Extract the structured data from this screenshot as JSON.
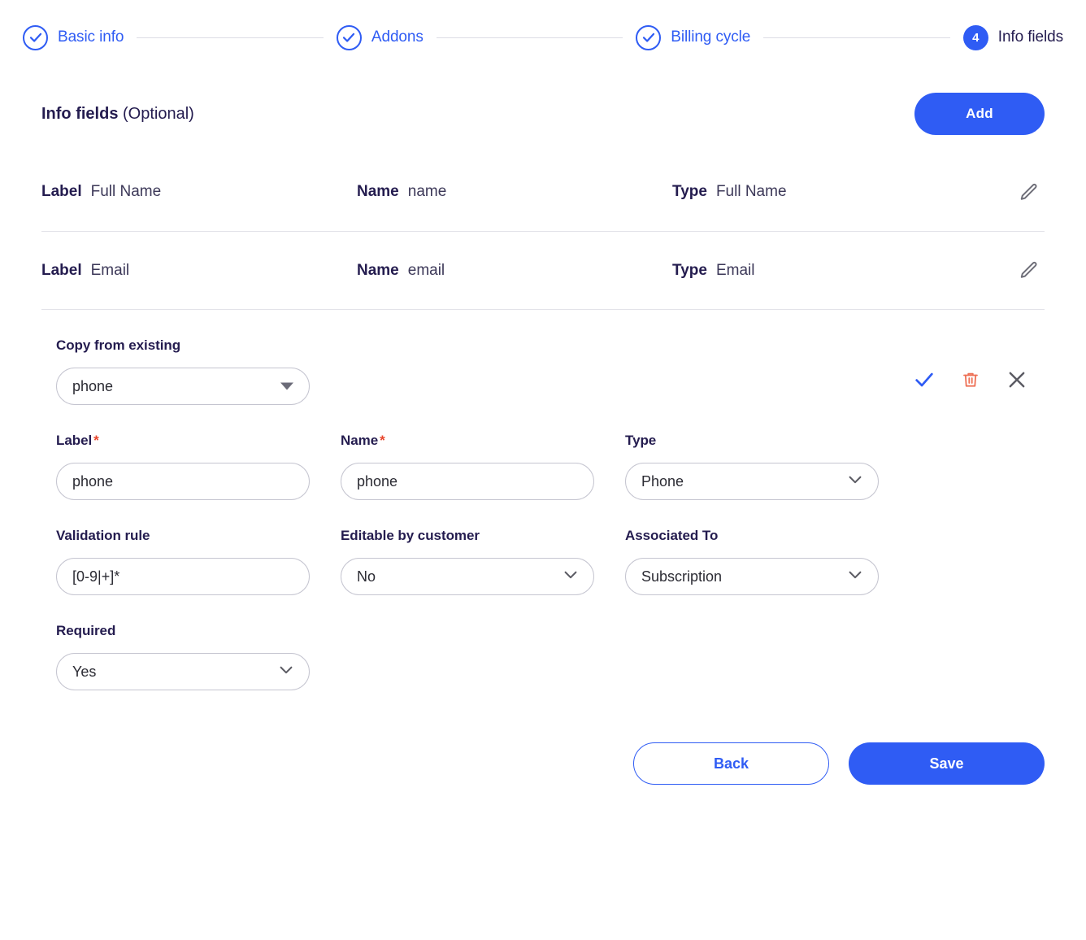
{
  "stepper": {
    "steps": [
      {
        "label": "Basic info",
        "state": "done",
        "icon": "check-circle-icon"
      },
      {
        "label": "Addons",
        "state": "done",
        "icon": "check-circle-icon"
      },
      {
        "label": "Billing cycle",
        "state": "done",
        "icon": "check-circle-icon"
      },
      {
        "label": "Info fields",
        "state": "active",
        "number": "4"
      }
    ]
  },
  "section": {
    "title_bold": "Info fields",
    "title_rest": " (Optional)",
    "add_label": "Add"
  },
  "existing_fields": {
    "keys": {
      "label": "Label",
      "name": "Name",
      "type": "Type"
    },
    "rows": [
      {
        "label": "Full Name",
        "name": "name",
        "type": "Full Name"
      },
      {
        "label": "Email",
        "name": "email",
        "type": "Email"
      }
    ],
    "edit_icon": "pencil-icon"
  },
  "editor": {
    "copy_from_existing": {
      "label": "Copy from existing",
      "value": "phone"
    },
    "actions": {
      "confirm": "check-icon",
      "delete": "trash-icon",
      "cancel": "close-icon"
    },
    "fields": {
      "label": {
        "label": "Label",
        "required": "*",
        "value": "phone"
      },
      "name": {
        "label": "Name",
        "required": "*",
        "value": "phone"
      },
      "type": {
        "label": "Type",
        "value": "Phone"
      },
      "validation_rule": {
        "label": "Validation rule",
        "value": "[0-9|+]*"
      },
      "editable_by_customer": {
        "label": "Editable by customer",
        "value": "No"
      },
      "associated_to": {
        "label": "Associated To",
        "value": "Subscription"
      },
      "required": {
        "label": "Required",
        "value": "Yes"
      }
    }
  },
  "footer": {
    "back_label": "Back",
    "save_label": "Save"
  },
  "colors": {
    "accent": "#2f5cf4",
    "text": "#241c4f",
    "danger": "#e8462c",
    "trash": "#ee7055",
    "border": "#c5c5d0",
    "divider": "#e2e2e8"
  }
}
